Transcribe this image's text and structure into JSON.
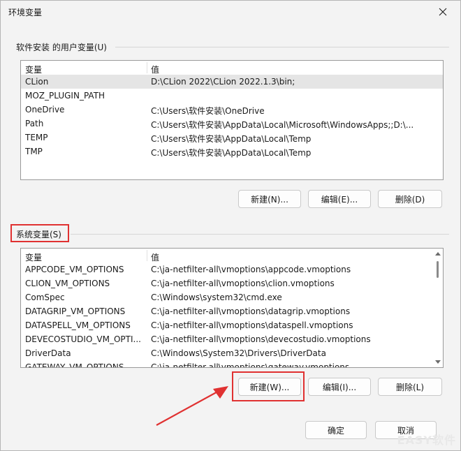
{
  "window": {
    "title": "环境变量",
    "close_icon": "close-icon"
  },
  "user_vars": {
    "group_title": "软件安装 的用户变量(U)",
    "col_name": "变量",
    "col_value": "值",
    "rows": [
      {
        "name": "CLion",
        "value": "D:\\CLion 2022\\CLion 2022.1.3\\bin;"
      },
      {
        "name": "MOZ_PLUGIN_PATH",
        "value": ""
      },
      {
        "name": "OneDrive",
        "value": "C:\\Users\\软件安装\\OneDrive"
      },
      {
        "name": "Path",
        "value": "C:\\Users\\软件安装\\AppData\\Local\\Microsoft\\WindowsApps;;D:\\..."
      },
      {
        "name": "TEMP",
        "value": "C:\\Users\\软件安装\\AppData\\Local\\Temp"
      },
      {
        "name": "TMP",
        "value": "C:\\Users\\软件安装\\AppData\\Local\\Temp"
      }
    ],
    "new_label": "新建(N)...",
    "edit_label": "编辑(E)...",
    "delete_label": "删除(D)"
  },
  "system_vars": {
    "group_title": "系统变量(S)",
    "col_name": "变量",
    "col_value": "值",
    "rows": [
      {
        "name": "APPCODE_VM_OPTIONS",
        "value": "C:\\ja-netfilter-all\\vmoptions\\appcode.vmoptions"
      },
      {
        "name": "CLION_VM_OPTIONS",
        "value": "C:\\ja-netfilter-all\\vmoptions\\clion.vmoptions"
      },
      {
        "name": "ComSpec",
        "value": "C:\\Windows\\system32\\cmd.exe"
      },
      {
        "name": "DATAGRIP_VM_OPTIONS",
        "value": "C:\\ja-netfilter-all\\vmoptions\\datagrip.vmoptions"
      },
      {
        "name": "DATASPELL_VM_OPTIONS",
        "value": "C:\\ja-netfilter-all\\vmoptions\\dataspell.vmoptions"
      },
      {
        "name": "DEVECOSTUDIO_VM_OPTI...",
        "value": "C:\\ja-netfilter-all\\vmoptions\\devecostudio.vmoptions"
      },
      {
        "name": "DriverData",
        "value": "C:\\Windows\\System32\\Drivers\\DriverData"
      },
      {
        "name": "GATEWAY_VM_OPTIONS",
        "value": "C:\\ja-netfilter-all\\vmoptions\\gateway.vmoptions"
      }
    ],
    "new_label": "新建(W)...",
    "edit_label": "编辑(I)...",
    "delete_label": "删除(L)"
  },
  "footer": {
    "ok_label": "确定",
    "cancel_label": "取消"
  },
  "annotation": {
    "color": "#e03131"
  },
  "watermark": "EASY软件"
}
